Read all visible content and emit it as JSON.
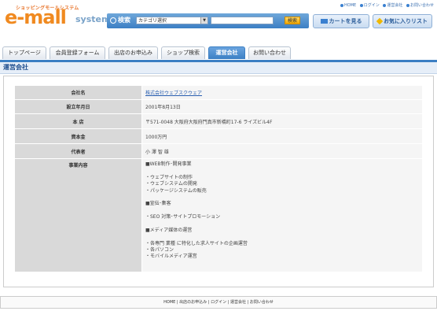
{
  "header": {
    "logo_sub": "ショッピングモールシステム",
    "logo_main": "e-mall",
    "logo_system": "system",
    "search_label": "検索",
    "category_value": "カテゴリ選択",
    "search_button": "検索",
    "cart_button": "カートを見る",
    "favorites_button": "お気に入りリスト",
    "top_links": [
      "HOME",
      "ログイン",
      "運営会社",
      "お問い合わせ"
    ]
  },
  "nav": {
    "tabs": [
      {
        "label": "トップページ"
      },
      {
        "label": "会員登録フォーム"
      },
      {
        "label": "出店のお申込み"
      },
      {
        "label": "ショップ検索"
      },
      {
        "label": "運営会社"
      },
      {
        "label": "お問い合わせ"
      }
    ],
    "active_index": 4
  },
  "page_title": "運営会社",
  "company": {
    "rows": [
      {
        "label": "会社名",
        "value": "株式会社ウェブスクウェア"
      },
      {
        "label": "設立年月日",
        "value": "2001年8月13日"
      },
      {
        "label": "本 店",
        "value": "〒571-0048 大阪府大阪府門真市新橋町17-6 ライズビル4F"
      },
      {
        "label": "資本金",
        "value": "1000万円"
      },
      {
        "label": "代表者",
        "value": "小 澤 智 雄"
      },
      {
        "label": "事業内容",
        "value": ""
      }
    ],
    "business_lines": [
      "■WEB制作･開発事業",
      "",
      "・ウェブサイトの制作",
      "・ウェブシステムの開発",
      "・パッケージシステムの販売",
      "",
      "■宣伝･集客",
      "",
      "・SEO 対策･サイトプロモーション",
      "",
      "■メディア媒体の運営",
      "",
      "・各専門 業種 に特化した求人サイトの企画運営",
      "・各パソコン",
      "・モバイルメディア運営"
    ]
  },
  "footer": {
    "links": [
      "HOME",
      "出店のお申込み",
      "ログイン",
      "運営会社",
      "お問い合わせ"
    ],
    "separator": " | "
  },
  "colors": {
    "accent": "#3b7fc4",
    "logo_orange": "#f08a20",
    "title_text": "#1f4f8f"
  }
}
